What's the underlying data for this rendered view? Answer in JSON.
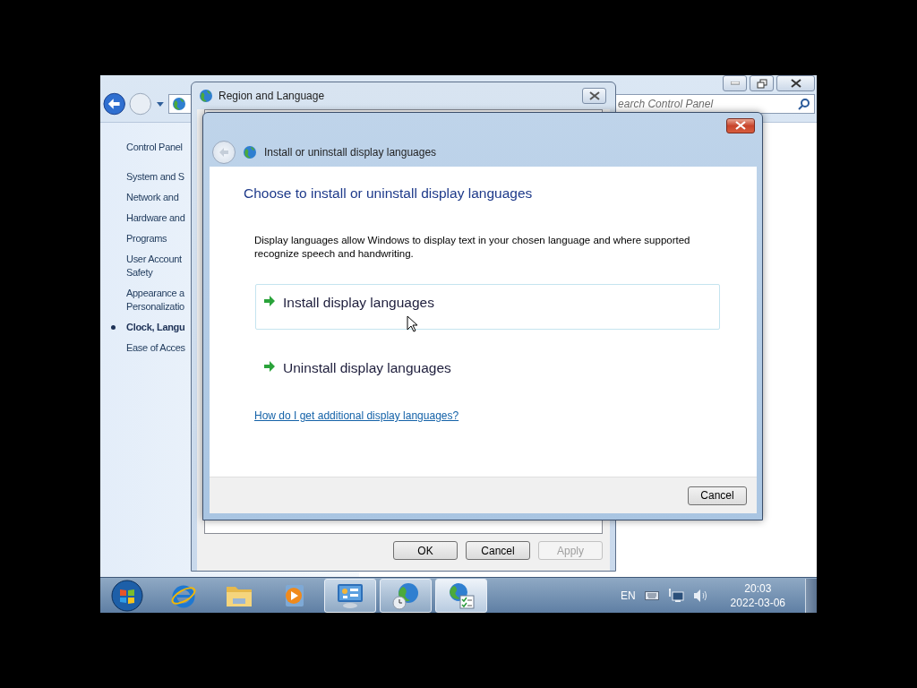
{
  "control_panel": {
    "search_placeholder": "earch Control Panel",
    "sidebar": [
      {
        "lines": [
          "Control Panel"
        ],
        "selected": false
      },
      {
        "lines": [
          "System and S"
        ],
        "selected": false
      },
      {
        "lines": [
          "Network and"
        ],
        "selected": false
      },
      {
        "lines": [
          "Hardware and"
        ],
        "selected": false
      },
      {
        "lines": [
          "Programs"
        ],
        "selected": false
      },
      {
        "lines": [
          "User Account",
          "Safety"
        ],
        "selected": false
      },
      {
        "lines": [
          "Appearance a",
          "Personalizatio"
        ],
        "selected": false
      },
      {
        "lines": [
          "Clock, Langu"
        ],
        "selected": true
      },
      {
        "lines": [
          "Ease of Acces"
        ],
        "selected": false
      }
    ]
  },
  "region_window": {
    "title": "Region and Language",
    "buttons": [
      {
        "label": "OK",
        "disabled": false
      },
      {
        "label": "Cancel",
        "disabled": false
      },
      {
        "label": "Apply",
        "disabled": true
      }
    ]
  },
  "install_dialog": {
    "title": "Install or uninstall display languages",
    "heading": "Choose to install or uninstall display languages",
    "description": "Display languages allow Windows to display text in your chosen language and where supported recognize speech and handwriting.",
    "options": [
      {
        "label": "Install display languages",
        "hovered": true
      },
      {
        "label": "Uninstall display languages",
        "hovered": false
      }
    ],
    "link": "How do I get additional display languages?",
    "cancel": "Cancel"
  },
  "taskbar": {
    "items": [
      {
        "kind": "ie",
        "running": false,
        "selected": false
      },
      {
        "kind": "folder",
        "running": false,
        "selected": false
      },
      {
        "kind": "media",
        "running": false,
        "selected": false
      },
      {
        "kind": "control",
        "running": true,
        "selected": false
      },
      {
        "kind": "globe-clock",
        "running": true,
        "selected": false
      },
      {
        "kind": "globe-check",
        "running": true,
        "selected": true
      }
    ],
    "language": "EN",
    "time": "20:03",
    "date": "2022-03-06"
  }
}
